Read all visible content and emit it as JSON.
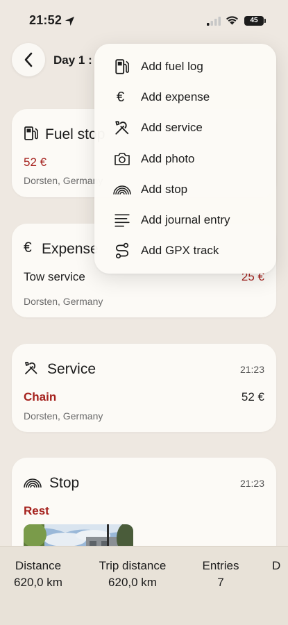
{
  "status": {
    "time": "21:52",
    "battery": "45"
  },
  "header": {
    "title": "Day 1 :"
  },
  "cards": {
    "fuel": {
      "title": "Fuel stop",
      "amount": "52 €",
      "location": "Dorsten, Germany"
    },
    "expense": {
      "title": "Expense",
      "desc": "Tow service",
      "amount": "25 €",
      "location": "Dorsten, Germany"
    },
    "service": {
      "title": "Service",
      "time": "21:23",
      "item": "Chain",
      "amount": "52 €",
      "location": "Dorsten, Germany"
    },
    "stop": {
      "title": "Stop",
      "time": "21:23",
      "item": "Rest"
    }
  },
  "menu": {
    "items": [
      {
        "label": "Add fuel log",
        "icon": "fuel-pump-icon"
      },
      {
        "label": "Add expense",
        "icon": "euro-icon"
      },
      {
        "label": "Add service",
        "icon": "tools-icon"
      },
      {
        "label": "Add photo",
        "icon": "camera-icon"
      },
      {
        "label": "Add stop",
        "icon": "rainbow-icon"
      },
      {
        "label": "Add journal entry",
        "icon": "text-lines-icon"
      },
      {
        "label": "Add GPX track",
        "icon": "route-icon"
      }
    ]
  },
  "stats": {
    "distance_label": "Distance",
    "distance_value": "620,0 km",
    "trip_label": "Trip distance",
    "trip_value": "620,0 km",
    "entries_label": "Entries",
    "entries_value": "7",
    "extra_label": "D"
  },
  "colors": {
    "accent_red": "#a5211d",
    "background": "#eee8e1",
    "card": "#fcfaf6"
  }
}
